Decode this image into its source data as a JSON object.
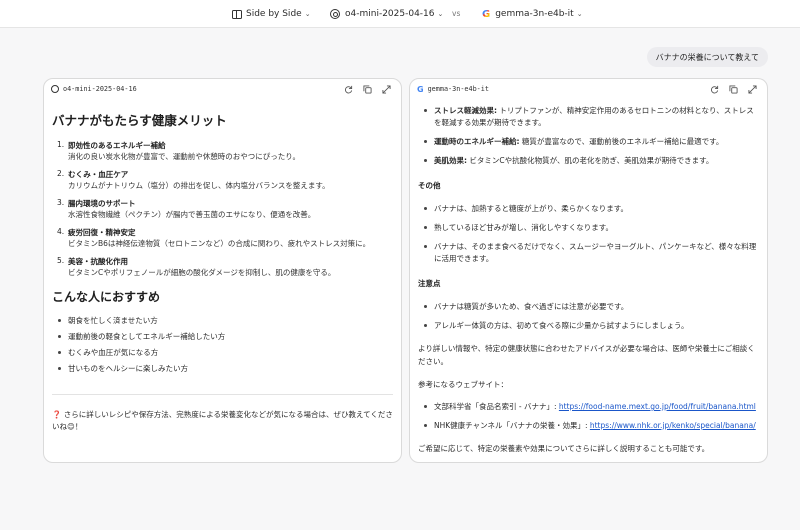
{
  "topbar": {
    "mode_label": "Side by Side",
    "model_a": "o4-mini-2025-04-16",
    "vs": "vs",
    "model_b": "gemma-3n-e4b-it"
  },
  "user_message": "バナナの栄養について教えて",
  "left": {
    "model": "o4-mini-2025-04-16",
    "title": "バナナがもたらす健康メリット",
    "benefits": [
      {
        "num": "1.",
        "title": "即効性のあるエネルギー補給",
        "desc": "消化の良い炭水化物が豊富で、運動前や休憩時のおやつにぴったり。"
      },
      {
        "num": "2.",
        "title": "むくみ・血圧ケア",
        "desc": "カリウムがナトリウム（塩分）の排出を促し、体内塩分バランスを整えます。"
      },
      {
        "num": "3.",
        "title": "腸内環境のサポート",
        "desc": "水溶性食物繊維（ペクチン）が腸内で善玉菌のエサになり、便通を改善。"
      },
      {
        "num": "4.",
        "title": "疲労回復・精神安定",
        "desc": "ビタミンB6は神経伝達物質（セロトニンなど）の合成に関わり、疲れやストレス対策に。"
      },
      {
        "num": "5.",
        "title": "美容・抗酸化作用",
        "desc": "ビタミンCやポリフェノールが細胞の酸化ダメージを抑制し、肌の健康を守る。"
      }
    ],
    "recommend_title": "こんな人におすすめ",
    "recommend": [
      "朝食を忙しく済ませたい方",
      "運動前後の軽食としてエネルギー補給したい方",
      "むくみや血圧が気になる方",
      "甘いものをヘルシーに楽しみたい方"
    ],
    "closing": "❓ さらに詳しいレシピや保存方法、完熟度による栄養変化などが気になる場合は、ぜひ教えてくださいね😊！"
  },
  "right": {
    "model": "gemma-3n-e4b-it",
    "effects": [
      {
        "bold": "ストレス軽減効果:",
        "text": " トリプトファンが、精神安定作用のあるセロトニンの材料となり、ストレスを軽減する効果が期待できます。"
      },
      {
        "bold": "運動時のエネルギー補給:",
        "text": " 糖質が豊富なので、運動前後のエネルギー補給に最適です。"
      },
      {
        "bold": "美肌効果:",
        "text": " ビタミンCや抗酸化物質が、肌の老化を防ぎ、美肌効果が期待できます。"
      }
    ],
    "other_title": "その他",
    "other": [
      "バナナは、加熱すると糖度が上がり、柔らかくなります。",
      "熟しているほど甘みが増し、消化しやすくなります。",
      "バナナは、そのまま食べるだけでなく、スムージーやヨーグルト、パンケーキなど、様々な料理に活用できます。"
    ],
    "caution_title": "注意点",
    "caution": [
      "バナナは糖質が多いため、食べ過ぎには注意が必要です。",
      "アレルギー体質の方は、初めて食べる際に少量から試すようにしましょう。"
    ],
    "advice": "より詳しい情報や、特定の健康状態に合わせたアドバイスが必要な場合は、医師や栄養士にご相談ください。",
    "refs_intro": "参考になるウェブサイト：",
    "refs": [
      {
        "label": "文部科学省「食品名索引 - バナナ」: ",
        "url": "https://food-name.mext.go.jp/food/fruit/banana.html"
      },
      {
        "label": "NHK健康チャンネル「バナナの栄養・効果」: ",
        "url": "https://www.nhk.or.jp/kenko/special/banana/"
      }
    ],
    "closing": "ご希望に応じて、特定の栄養素や効果についてさらに詳しく説明することも可能です。"
  }
}
